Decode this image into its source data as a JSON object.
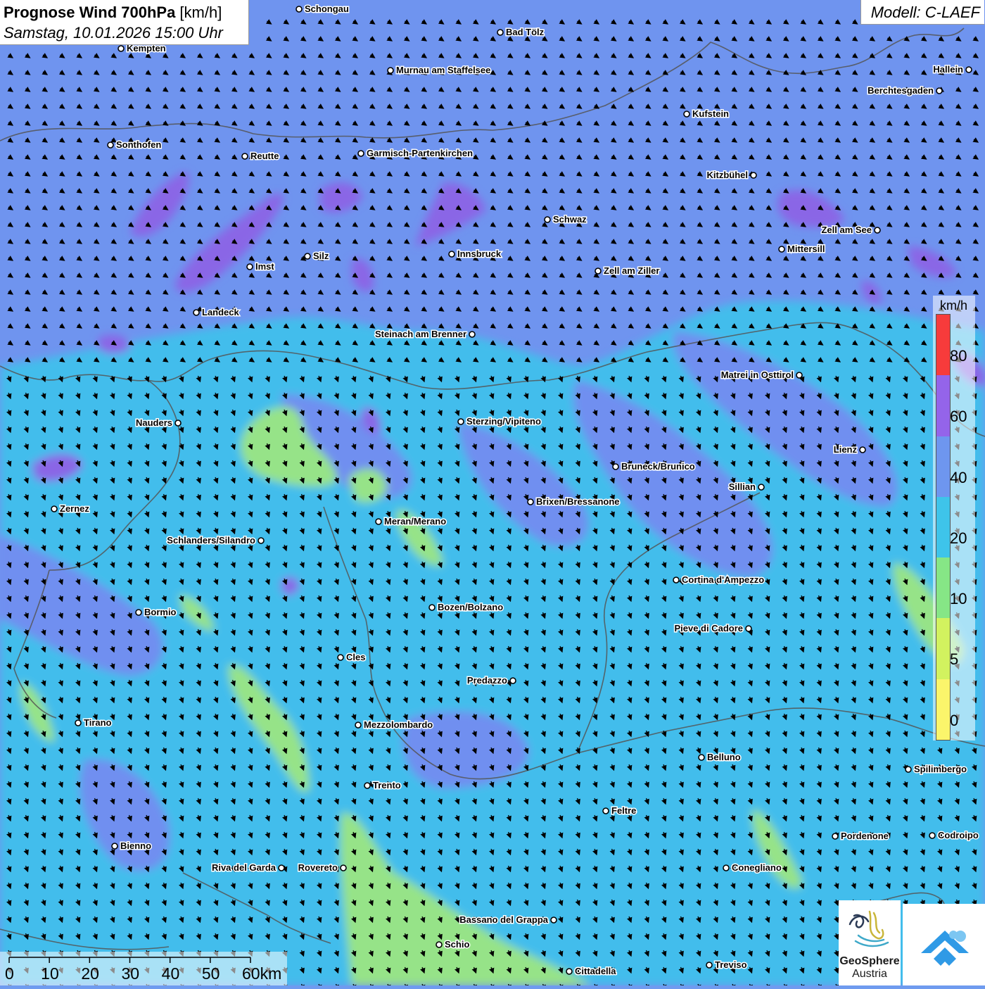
{
  "title": {
    "main_bold": "Prognose Wind 700hPa",
    "main_unit": " [km/h]",
    "datetime": "Samstag, 10.01.2026 15:00 Uhr"
  },
  "model_label": "Modell: C-LAEF",
  "legend": {
    "unit": "km/h",
    "labels": [
      "80",
      "60",
      "40",
      "20",
      "10",
      "5",
      "0"
    ],
    "colors": [
      "#f73b3b",
      "#9464ea",
      "#6e96ef",
      "#3ec4ea",
      "#86e686",
      "#d2f25f",
      "#fbf56b"
    ]
  },
  "scale_bar": {
    "labels": [
      "0",
      "10",
      "20",
      "30",
      "40",
      "50",
      "60km"
    ]
  },
  "logo": {
    "name": "GeoSphere",
    "sub": "Austria",
    "icon": "geosphere-logo-icon",
    "app_icon": "cloud-arrow-icon"
  },
  "colors": {
    "high_wind": "#8a66e6",
    "mid_wind": "#6f8ff0",
    "low_wind": "#44bcec",
    "calm": "#96e388",
    "border": "#555555"
  },
  "cities": [
    {
      "name": "Schongau"
    },
    {
      "name": "Bad Tölz"
    },
    {
      "name": "Kempten"
    },
    {
      "name": "Murnau am Staffelsee"
    },
    {
      "name": "Hallein"
    },
    {
      "name": "Berchtesgaden"
    },
    {
      "name": "Kufstein"
    },
    {
      "name": "Sonthofen"
    },
    {
      "name": "Reutte"
    },
    {
      "name": "Garmisch-Partenkirchen"
    },
    {
      "name": "Kitzbühel"
    },
    {
      "name": "Schwaz"
    },
    {
      "name": "Zell am See"
    },
    {
      "name": "Innsbruck"
    },
    {
      "name": "Mittersill"
    },
    {
      "name": "Imst"
    },
    {
      "name": "Silz"
    },
    {
      "name": "Zell am Ziller"
    },
    {
      "name": "Landeck"
    },
    {
      "name": "Steinach am Brenner"
    },
    {
      "name": "Matrei in Osttirol"
    },
    {
      "name": "Nauders"
    },
    {
      "name": "Sterzing/Vipiteno"
    },
    {
      "name": "Lienz"
    },
    {
      "name": "Bruneck/Brunico"
    },
    {
      "name": "Sillian"
    },
    {
      "name": "Zernez"
    },
    {
      "name": "Brixen/Bressanone"
    },
    {
      "name": "Meran/Merano"
    },
    {
      "name": "Schlanders/Silandro"
    },
    {
      "name": "Cortina d'Ampezzo"
    },
    {
      "name": "Bozen/Bolzano"
    },
    {
      "name": "Bormio"
    },
    {
      "name": "Pieve di Cadore"
    },
    {
      "name": "Cles"
    },
    {
      "name": "Predazzo"
    },
    {
      "name": "Tirano"
    },
    {
      "name": "Mezzolombardo"
    },
    {
      "name": "Belluno"
    },
    {
      "name": "Spilimbergo"
    },
    {
      "name": "Trento"
    },
    {
      "name": "Feltre"
    },
    {
      "name": "Bienno"
    },
    {
      "name": "Pordenone"
    },
    {
      "name": "Codroipo"
    },
    {
      "name": "Riva del Garda"
    },
    {
      "name": "Rovereto"
    },
    {
      "name": "Conegliano"
    },
    {
      "name": "Bassano del Grappa"
    },
    {
      "name": "Schio"
    },
    {
      "name": "Treviso"
    },
    {
      "name": "Cittadella"
    }
  ]
}
